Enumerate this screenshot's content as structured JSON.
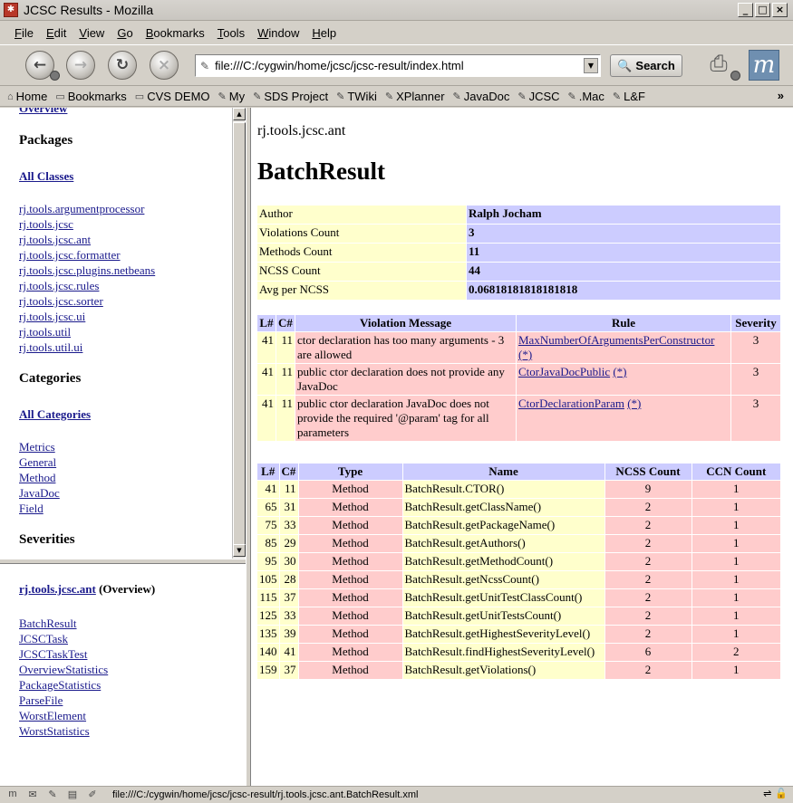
{
  "window": {
    "title": "JCSC Results - Mozilla"
  },
  "menu": [
    "File",
    "Edit",
    "View",
    "Go",
    "Bookmarks",
    "Tools",
    "Window",
    "Help"
  ],
  "nav": {
    "url": "file:///C:/cygwin/home/jcsc/jcsc-result/index.html",
    "search_label": "Search"
  },
  "bookmarks": [
    "Home",
    "Bookmarks",
    "CVS DEMO",
    "My",
    "SDS Project",
    "TWiki",
    "XPlanner",
    "JavaDoc",
    "JCSC",
    ".Mac",
    "L&F"
  ],
  "left_top": {
    "overview_link": "Overview",
    "packages_heading": "Packages",
    "all_classes": "All Classes",
    "packages": [
      "rj.tools.argumentprocessor",
      "rj.tools.jcsc",
      "rj.tools.jcsc.ant",
      "rj.tools.jcsc.formatter",
      "rj.tools.jcsc.plugins.netbeans",
      "rj.tools.jcsc.rules",
      "rj.tools.jcsc.sorter",
      "rj.tools.jcsc.ui",
      "rj.tools.util",
      "rj.tools.util.ui"
    ],
    "categories_heading": "Categories",
    "all_categories": "All Categories",
    "categories": [
      "Metrics",
      "General",
      "Method",
      "JavaDoc",
      "Field"
    ],
    "severities_heading": "Severities"
  },
  "left_bottom": {
    "package_link": "rj.tools.jcsc.ant",
    "overview_suffix": "(Overview)",
    "classes": [
      "BatchResult",
      "JCSCTask",
      "JCSCTaskTest",
      "OverviewStatistics",
      "PackageStatistics",
      "ParseFile",
      "WorstElement",
      "WorstStatistics"
    ]
  },
  "main": {
    "package": "rj.tools.jcsc.ant",
    "class_name": "BatchResult",
    "info": [
      {
        "label": "Author",
        "value": "Ralph Jocham"
      },
      {
        "label": "Violations Count",
        "value": "3"
      },
      {
        "label": "Methods Count",
        "value": "11"
      },
      {
        "label": "NCSS Count",
        "value": "44"
      },
      {
        "label": "Avg per NCSS",
        "value": "0.06818181818181818"
      }
    ],
    "violation_headers": [
      "L#",
      "C#",
      "Violation Message",
      "Rule",
      "Severity"
    ],
    "violations": [
      {
        "l": "41",
        "c": "11",
        "msg": "ctor declaration has too many arguments - 3 are allowed",
        "rule": "MaxNumberOfArgumentsPerConstructor",
        "star": "(*)",
        "sev": "3"
      },
      {
        "l": "41",
        "c": "11",
        "msg": "public ctor declaration does not provide any JavaDoc",
        "rule": "CtorJavaDocPublic",
        "star": "(*)",
        "sev": "3"
      },
      {
        "l": "41",
        "c": "11",
        "msg": "public ctor declaration JavaDoc does not provide the required '@param' tag for all parameters",
        "rule": "CtorDeclarationParam",
        "star": "(*)",
        "sev": "3"
      }
    ],
    "method_headers": [
      "L#",
      "C#",
      "Type",
      "Name",
      "NCSS Count",
      "CCN Count"
    ],
    "methods": [
      {
        "l": "41",
        "c": "11",
        "type": "Method",
        "name": "BatchResult.CTOR()",
        "ncss": "9",
        "ccn": "1"
      },
      {
        "l": "65",
        "c": "31",
        "type": "Method",
        "name": "BatchResult.getClassName()",
        "ncss": "2",
        "ccn": "1"
      },
      {
        "l": "75",
        "c": "33",
        "type": "Method",
        "name": "BatchResult.getPackageName()",
        "ncss": "2",
        "ccn": "1"
      },
      {
        "l": "85",
        "c": "29",
        "type": "Method",
        "name": "BatchResult.getAuthors()",
        "ncss": "2",
        "ccn": "1"
      },
      {
        "l": "95",
        "c": "30",
        "type": "Method",
        "name": "BatchResult.getMethodCount()",
        "ncss": "2",
        "ccn": "1"
      },
      {
        "l": "105",
        "c": "28",
        "type": "Method",
        "name": "BatchResult.getNcssCount()",
        "ncss": "2",
        "ccn": "1"
      },
      {
        "l": "115",
        "c": "37",
        "type": "Method",
        "name": "BatchResult.getUnitTestClassCount()",
        "ncss": "2",
        "ccn": "1"
      },
      {
        "l": "125",
        "c": "33",
        "type": "Method",
        "name": "BatchResult.getUnitTestsCount()",
        "ncss": "2",
        "ccn": "1"
      },
      {
        "l": "135",
        "c": "39",
        "type": "Method",
        "name": "BatchResult.getHighestSeverityLevel()",
        "ncss": "2",
        "ccn": "1"
      },
      {
        "l": "140",
        "c": "41",
        "type": "Method",
        "name": "BatchResult.findHighestSeverityLevel()",
        "ncss": "6",
        "ccn": "2"
      },
      {
        "l": "159",
        "c": "37",
        "type": "Method",
        "name": "BatchResult.getViolations()",
        "ncss": "2",
        "ccn": "1"
      }
    ]
  },
  "status": {
    "text": "file:///C:/cygwin/home/jcsc/jcsc-result/rj.tools.jcsc.ant.BatchResult.xml"
  },
  "colors": {
    "yellow_cell": "#ffffcc",
    "lavender_cell": "#ccccff",
    "pink_cell": "#ffcccc",
    "link": "#1a1a8c"
  }
}
